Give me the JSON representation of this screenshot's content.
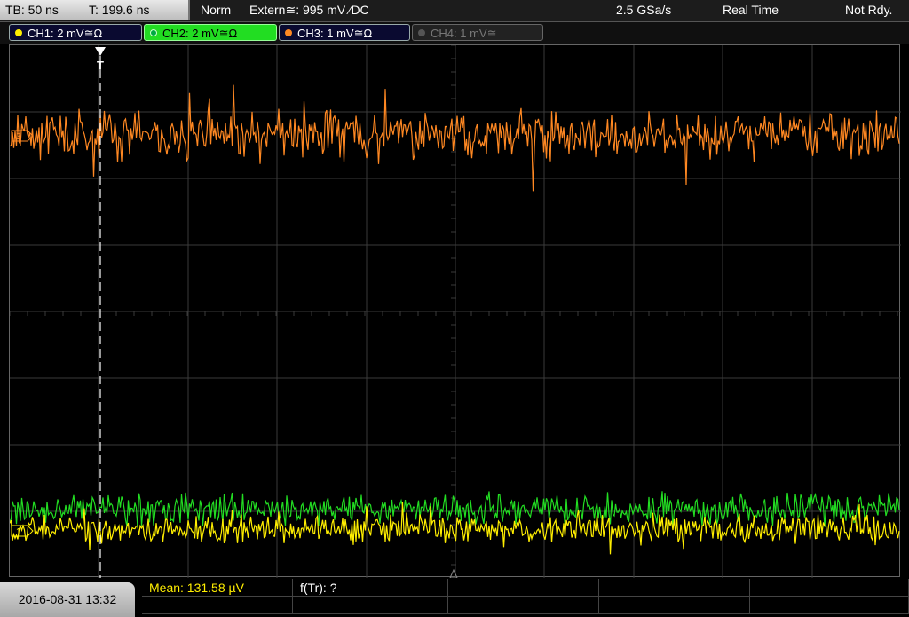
{
  "top": {
    "timebase": "TB: 50 ns",
    "trigger_time": "T: 199.6 ns",
    "trigger_mode": "Norm",
    "trigger_source": "Extern≅: 995 mV ⁄DC",
    "sample_rate": "2.5 GSa/s",
    "acq_mode": "Real Time",
    "status": "Not Rdy."
  },
  "channels": [
    {
      "label": "CH1: 2 mV≅Ω",
      "color": "#ffee00",
      "active": true
    },
    {
      "label": "CH2: 2 mV≅Ω",
      "color": "#22dd22",
      "active": true,
      "selected": true
    },
    {
      "label": "CH3: 1 mV≅Ω",
      "color": "#ff8822",
      "active": true
    },
    {
      "label": "CH4: 1 mV≅",
      "color": "#777777",
      "active": false
    }
  ],
  "markers": {
    "trigger_marker": "T",
    "ch3_marker": "3",
    "ch1_marker": "1"
  },
  "bottom": {
    "datetime": "2016-08-31 13:32",
    "meas1": "Mean: 131.58 µV",
    "meas2": "f(Tr): ?"
  },
  "colors": {
    "ch1": "#ffee00",
    "ch2": "#22dd22",
    "ch3": "#ff8822",
    "grid": "#3a3a3a"
  }
}
